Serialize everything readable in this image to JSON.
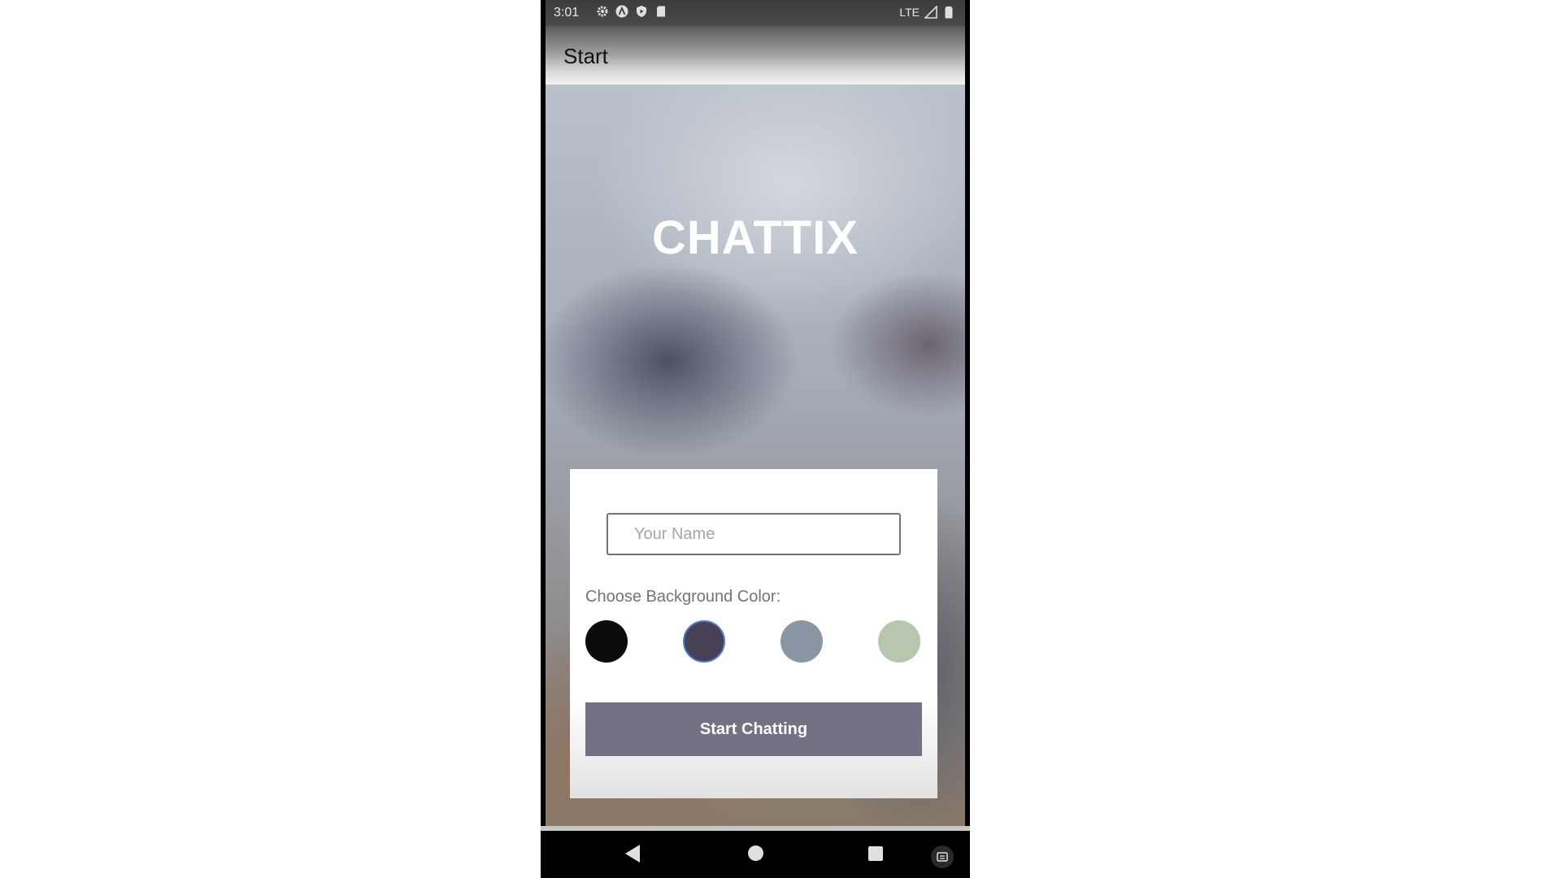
{
  "status_bar": {
    "time": "3:01",
    "network": "LTE",
    "left_icons": [
      "settings-icon",
      "app-a-icon",
      "shield-play-icon",
      "sd-card-icon"
    ],
    "right_icons": [
      "signal-icon",
      "battery-icon"
    ]
  },
  "app_bar": {
    "title": "Start"
  },
  "hero": {
    "app_name": "CHATTIX"
  },
  "form": {
    "name_placeholder": "Your Name",
    "name_value": "",
    "color_label": "Choose Background Color:",
    "colors": [
      {
        "name": "black",
        "hex": "#090C08"
      },
      {
        "name": "purple",
        "hex": "#474056"
      },
      {
        "name": "gray",
        "hex": "#8A95A5"
      },
      {
        "name": "green",
        "hex": "#B9C6AE"
      }
    ],
    "selected_color_index": 1,
    "start_button_label": "Start Chatting"
  },
  "colors": {
    "accent": "#757083",
    "selection_ring": "#4E7BD0"
  },
  "nav_bar": {
    "buttons": [
      "back-icon",
      "home-icon",
      "recents-icon",
      "screenshot-icon"
    ]
  }
}
